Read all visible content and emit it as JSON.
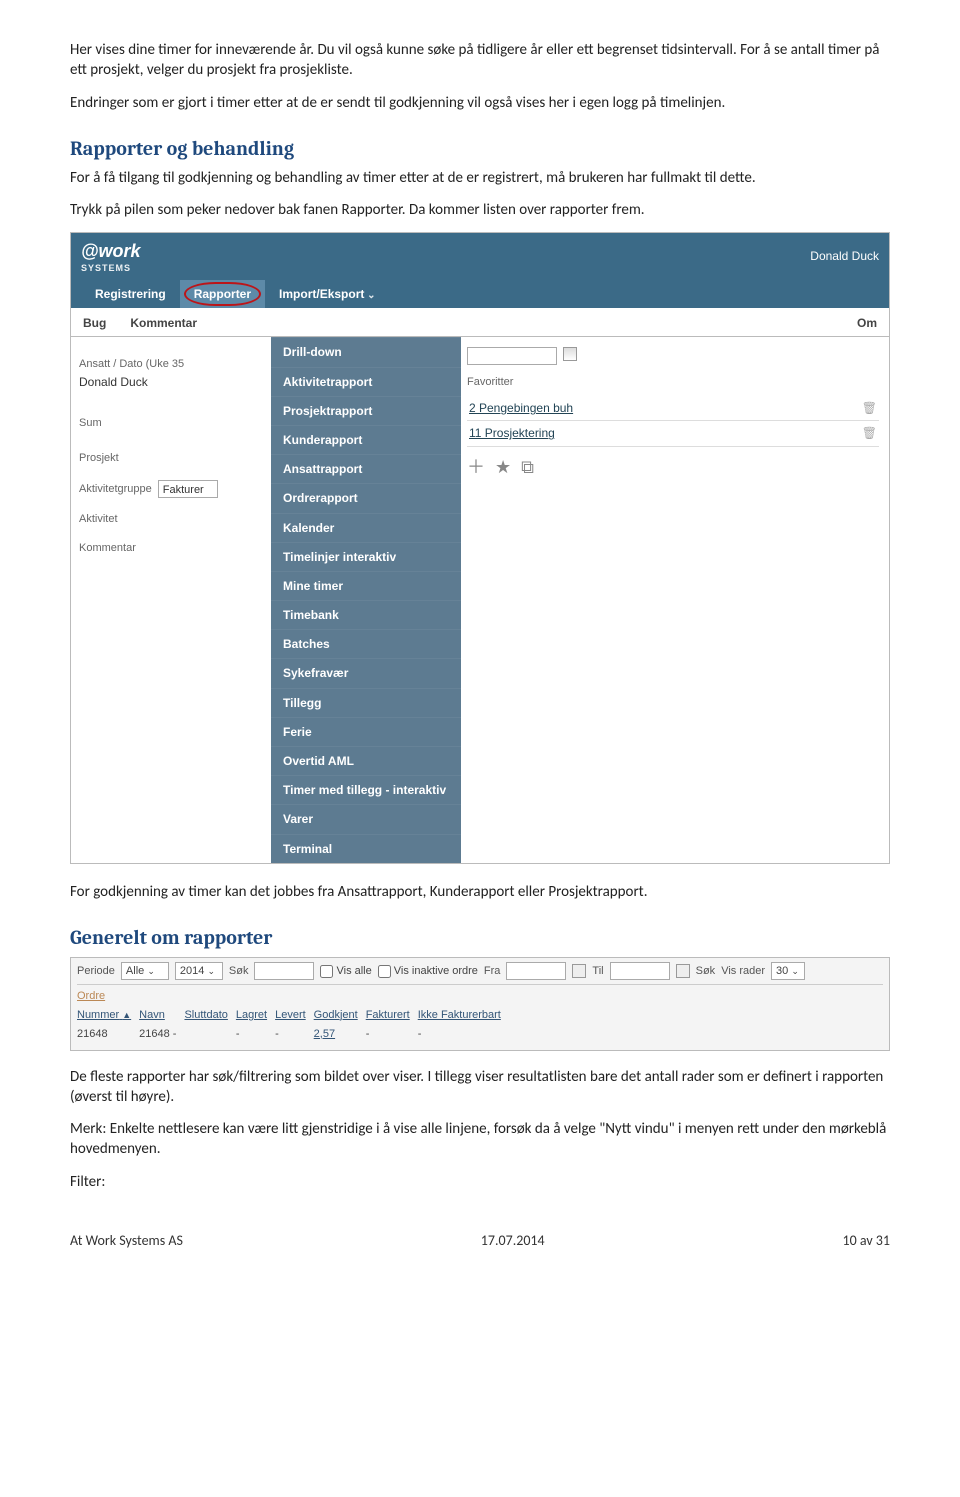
{
  "para1": "Her vises dine timer for inneværende år. Du vil også kunne søke på tidligere år eller ett begrenset tidsintervall. For å se antall timer på ett prosjekt, velger du prosjekt fra prosjekliste.",
  "para2": "Endringer som er gjort i timer etter at de er sendt til godkjenning vil også vises her i egen logg på timelinjen.",
  "h_rapporter": "Rapporter og behandling",
  "para3": "For å få tilgang til godkjenning og behandling av timer etter at de er registrert, må brukeren har fullmakt til dette.",
  "para4": "Trykk på pilen som peker nedover bak fanen Rapporter. Da kommer listen over rapporter frem.",
  "para5": "For godkjenning av timer kan det jobbes fra Ansattrapport, Kunderapport eller Prosjektrapport.",
  "h_generelt": "Generelt om rapporter",
  "para6": "De fleste rapporter har søk/filtrering som bildet over viser. I tillegg viser resultatlisten bare det antall rader som er definert i rapporten (øverst til høyre).",
  "para7": "Merk: Enkelte nettlesere kan være litt gjenstridige i å vise alle linjene, forsøk da å velge \"Nytt vindu\" i menyen rett under den mørkeblå hovedmenyen.",
  "para8": "Filter:",
  "footer": {
    "left": "At Work Systems AS",
    "mid": "17.07.2014",
    "right": "10 av 31"
  },
  "shot1": {
    "brand": "@work",
    "brand_sub": "SYSTEMS",
    "user": "Donald Duck",
    "tabs": [
      "Registrering",
      "Rapporter",
      "Import/Eksport"
    ],
    "subtabs": [
      "Bug",
      "Kommentar"
    ],
    "subtab_right": "Om",
    "left": {
      "lbl_ansatt": "Ansatt / Dato (Uke 35",
      "val_ansatt": "Donald Duck",
      "lbl_sum": "Sum",
      "lbl_prosjekt": "Prosjekt",
      "lbl_aktgrp": "Aktivitetgruppe",
      "val_aktgrp": "Fakturer",
      "lbl_akt": "Aktivitet",
      "lbl_komm": "Kommentar"
    },
    "dropdown": [
      "Drill-down",
      "Aktivitetrapport",
      "Prosjektrapport",
      "Kunderapport",
      "Ansattrapport",
      "Ordrerapport",
      "Kalender",
      "Timelinjer interaktiv",
      "Mine timer",
      "Timebank",
      "Batches",
      "Sykefravær",
      "Tillegg",
      "Ferie",
      "Overtid AML",
      "Timer med tillegg - interaktiv",
      "Varer",
      "Terminal"
    ],
    "right": {
      "hdr": "Favoritter",
      "favs": [
        "2 Pengebingen buh",
        "11 Prosjektering"
      ]
    }
  },
  "shot2": {
    "filter": {
      "periode_lbl": "Periode",
      "periode_val": "Alle",
      "year_val": "2014",
      "sok_lbl": "Søk",
      "vis_alle": "Vis alle",
      "vis_inaktive": "Vis inaktive ordre",
      "fra_lbl": "Fra",
      "til_lbl": "Til",
      "sok_btn": "Søk",
      "vis_rader_lbl": "Vis rader",
      "vis_rader_val": "30"
    },
    "sub": "Ordre",
    "cols": [
      "Nummer",
      "Navn",
      "Sluttdato",
      "Lagret",
      "Levert",
      "Godkjent",
      "Fakturert",
      "Ikke Fakturerbart"
    ],
    "row": {
      "nummer": "21648",
      "navn": "21648 -",
      "sluttdato": "",
      "lagret": "-",
      "levert": "-",
      "godkjent": "2,57",
      "fakturert": "-",
      "ikke": "-"
    }
  }
}
